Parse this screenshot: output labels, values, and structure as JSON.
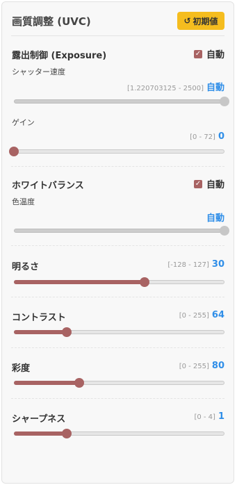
{
  "header": {
    "title": "画質調整 (UVC)",
    "reset_label": "初期値",
    "reset_icon": "reset-icon"
  },
  "exposure": {
    "title": "露出制御 (Exposure)",
    "auto_label": "自動",
    "auto_checked": true,
    "shutter": {
      "label": "シャッター速度",
      "range": "[1.220703125 - 2500]",
      "value": "自動",
      "level": 1.0
    },
    "gain": {
      "label": "ゲイン",
      "range": "[0 - 72]",
      "value": "0",
      "level": 0.0
    }
  },
  "white_balance": {
    "title": "ホワイトバランス",
    "auto_label": "自動",
    "auto_checked": true,
    "temp": {
      "label": "色温度",
      "value": "自動",
      "level": 1.0
    }
  },
  "brightness": {
    "title": "明るさ",
    "range": "[-128 - 127]",
    "value": "30",
    "level": 0.62
  },
  "contrast": {
    "title": "コントラスト",
    "range": "[0 - 255]",
    "value": "64",
    "level": 0.25
  },
  "saturation": {
    "title": "彩度",
    "range": "[0 - 255]",
    "value": "80",
    "level": 0.31
  },
  "sharpness": {
    "title": "シャープネス",
    "range": "[0 - 4]",
    "value": "1",
    "level": 0.25
  },
  "colors": {
    "accent": "#a86363",
    "value_blue": "#2f8ee8",
    "reset_bg": "#f5bd1f"
  }
}
